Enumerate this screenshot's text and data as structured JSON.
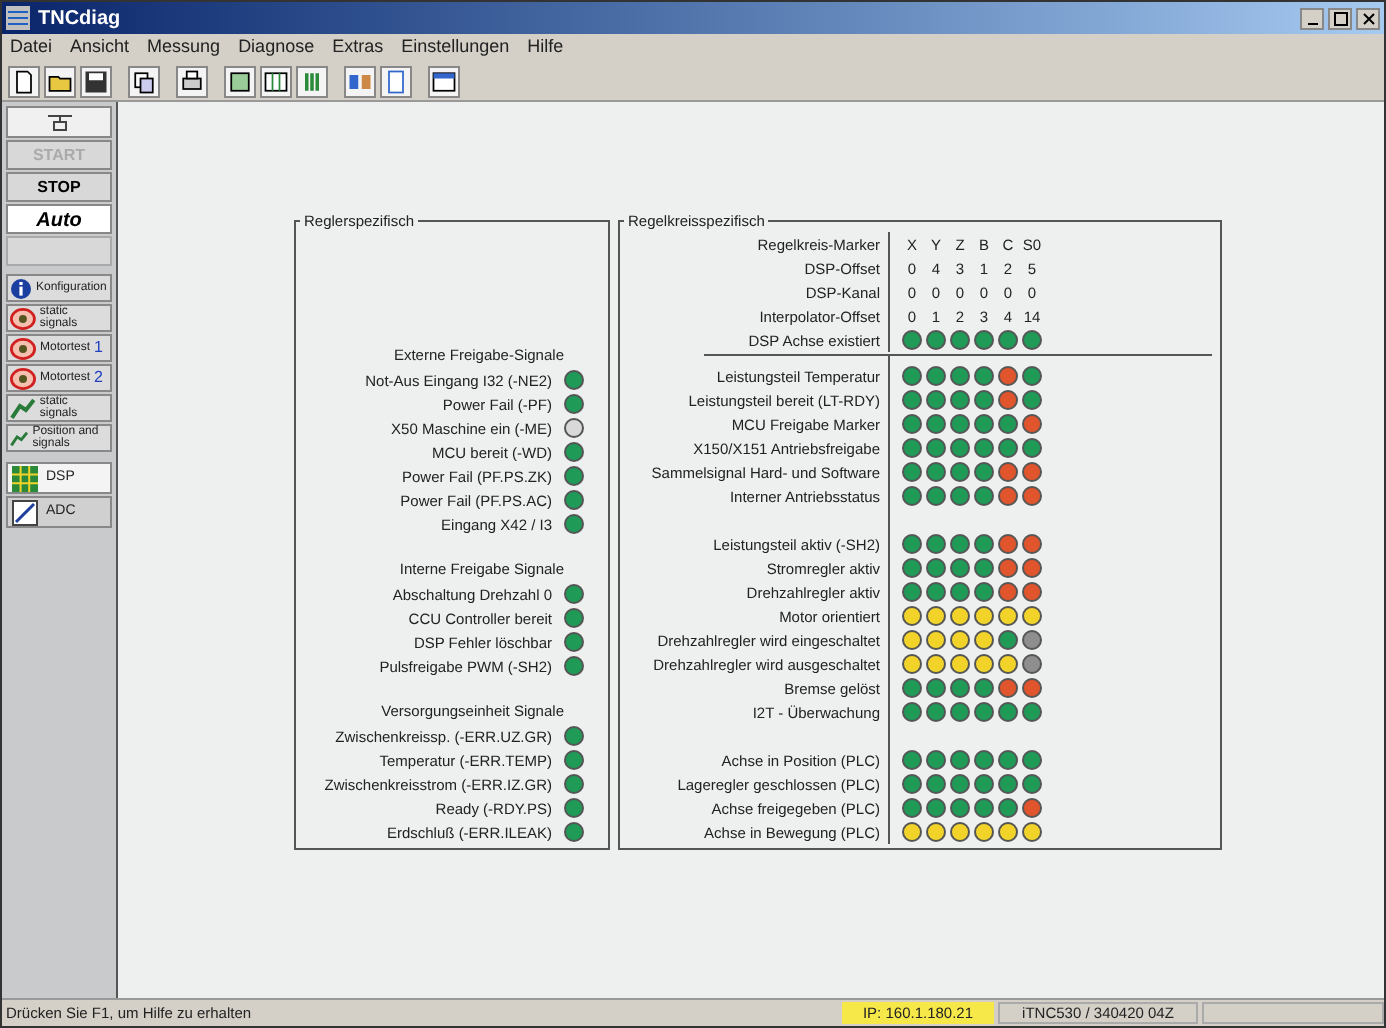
{
  "window": {
    "title": "TNCdiag"
  },
  "menu": [
    "Datei",
    "Ansicht",
    "Messung",
    "Diagnose",
    "Extras",
    "Einstellungen",
    "Hilfe"
  ],
  "sidebar": {
    "buttons": [
      {
        "label": "START",
        "disabled": true,
        "selected": false
      },
      {
        "label": "STOP",
        "disabled": false,
        "selected": false
      },
      {
        "label": "Auto",
        "disabled": false,
        "selected": true
      }
    ],
    "tools": [
      {
        "kind": "info",
        "label": "Konfiguration"
      },
      {
        "kind": "ring",
        "label": "static signals"
      },
      {
        "kind": "ring",
        "label": "Motortest",
        "suffix": "1"
      },
      {
        "kind": "ring",
        "label": "Motortest",
        "suffix": "2"
      },
      {
        "kind": "probe",
        "label": "static signals"
      },
      {
        "kind": "probe",
        "label": "Position and signals"
      }
    ],
    "tabs": [
      {
        "kind": "grid",
        "label": "DSP",
        "selected": true
      },
      {
        "kind": "pen",
        "label": "ADC",
        "selected": false
      }
    ]
  },
  "left_panel": {
    "title": "Reglerspezifisch",
    "groups": [
      {
        "heading": "Externe Freigabe-Signale",
        "rows": [
          {
            "label": "Not-Aus Eingang I32 (-NE2)",
            "color": "#1f9a57"
          },
          {
            "label": "Power Fail (-PF)",
            "color": "#1f9a57"
          },
          {
            "label": "X50 Maschine ein (-ME)",
            "color": "#d9d9d9"
          },
          {
            "label": "MCU bereit (-WD)",
            "color": "#1f9a57"
          },
          {
            "label": "Power Fail (PF.PS.ZK)",
            "color": "#1f9a57"
          },
          {
            "label": "Power Fail (PF.PS.AC)",
            "color": "#1f9a57"
          },
          {
            "label": "Eingang X42 / I3",
            "color": "#1f9a57"
          }
        ]
      },
      {
        "heading": "Interne Freigabe Signale",
        "rows": [
          {
            "label": "Abschaltung Drehzahl 0",
            "color": "#1f9a57"
          },
          {
            "label": "CCU Controller bereit",
            "color": "#1f9a57"
          },
          {
            "label": "DSP Fehler löschbar",
            "color": "#1f9a57"
          },
          {
            "label": "Pulsfreigabe PWM (-SH2)",
            "color": "#1f9a57"
          }
        ]
      },
      {
        "heading": "Versorgungseinheit Signale",
        "rows": [
          {
            "label": "Zwischenkreissp. (-ERR.UZ.GR)",
            "color": "#1f9a57"
          },
          {
            "label": "Temperatur (-ERR.TEMP)",
            "color": "#1f9a57"
          },
          {
            "label": "Zwischenkreisstrom (-ERR.IZ.GR)",
            "color": "#1f9a57"
          },
          {
            "label": "Ready (-RDY.PS)",
            "color": "#1f9a57"
          },
          {
            "label": "Erdschluß (-ERR.ILEAK)",
            "color": "#1f9a57"
          }
        ]
      }
    ]
  },
  "right_panel": {
    "title": "Regelkreisspezifisch",
    "header_rows": [
      {
        "label": "Regelkreis-Marker",
        "values": [
          "X",
          "Y",
          "Z",
          "B",
          "C",
          "S0"
        ]
      },
      {
        "label": "DSP-Offset",
        "values": [
          "0",
          "4",
          "3",
          "1",
          "2",
          "5"
        ]
      },
      {
        "label": "DSP-Kanal",
        "values": [
          "0",
          "0",
          "0",
          "0",
          "0",
          "0"
        ]
      },
      {
        "label": "Interpolator-Offset",
        "values": [
          "0",
          "1",
          "2",
          "3",
          "4",
          "14"
        ]
      }
    ],
    "axis_row": {
      "label": "DSP Achse existiert",
      "lamps": [
        {
          "color": "#1f9a57"
        },
        {
          "color": "#1f9a57"
        },
        {
          "color": "#1f9a57"
        },
        {
          "color": "#1f9a57"
        },
        {
          "color": "#1f9a57"
        },
        {
          "color": "#1f9a57"
        }
      ]
    },
    "groups": [
      [
        {
          "label": "Leistungsteil Temperatur",
          "lamps": [
            {
              "color": "#1f9a57"
            },
            {
              "color": "#1f9a57"
            },
            {
              "color": "#1f9a57"
            },
            {
              "color": "#1f9a57"
            },
            {
              "color": "#e0552b"
            },
            {
              "color": "#1f9a57"
            }
          ]
        },
        {
          "label": "Leistungsteil bereit (LT-RDY)",
          "lamps": [
            {
              "color": "#1f9a57"
            },
            {
              "color": "#1f9a57"
            },
            {
              "color": "#1f9a57"
            },
            {
              "color": "#1f9a57"
            },
            {
              "color": "#e0552b"
            },
            {
              "color": "#1f9a57"
            }
          ]
        },
        {
          "label": "MCU Freigabe Marker",
          "lamps": [
            {
              "color": "#1f9a57"
            },
            {
              "color": "#1f9a57"
            },
            {
              "color": "#1f9a57"
            },
            {
              "color": "#1f9a57"
            },
            {
              "color": "#1f9a57"
            },
            {
              "color": "#e0552b"
            }
          ]
        },
        {
          "label": "X150/X151 Antriebsfreigabe",
          "lamps": [
            {
              "color": "#1f9a57"
            },
            {
              "color": "#1f9a57"
            },
            {
              "color": "#1f9a57"
            },
            {
              "color": "#1f9a57"
            },
            {
              "color": "#1f9a57"
            },
            {
              "color": "#1f9a57"
            }
          ]
        },
        {
          "label": "Sammelsignal Hard- und Software",
          "lamps": [
            {
              "color": "#1f9a57"
            },
            {
              "color": "#1f9a57"
            },
            {
              "color": "#1f9a57"
            },
            {
              "color": "#1f9a57"
            },
            {
              "color": "#e0552b"
            },
            {
              "color": "#e0552b"
            }
          ]
        },
        {
          "label": "Interner Antriebsstatus",
          "lamps": [
            {
              "color": "#1f9a57"
            },
            {
              "color": "#1f9a57"
            },
            {
              "color": "#1f9a57"
            },
            {
              "color": "#1f9a57"
            },
            {
              "color": "#e0552b"
            },
            {
              "color": "#e0552b"
            }
          ]
        }
      ],
      [
        {
          "label": "Leistungsteil aktiv (-SH2)",
          "lamps": [
            {
              "color": "#1f9a57"
            },
            {
              "color": "#1f9a57"
            },
            {
              "color": "#1f9a57"
            },
            {
              "color": "#1f9a57"
            },
            {
              "color": "#e0552b"
            },
            {
              "color": "#e0552b"
            }
          ]
        },
        {
          "label": "Stromregler aktiv",
          "lamps": [
            {
              "color": "#1f9a57"
            },
            {
              "color": "#1f9a57"
            },
            {
              "color": "#1f9a57"
            },
            {
              "color": "#1f9a57"
            },
            {
              "color": "#e0552b"
            },
            {
              "color": "#e0552b"
            }
          ]
        },
        {
          "label": "Drehzahlregler aktiv",
          "lamps": [
            {
              "color": "#1f9a57"
            },
            {
              "color": "#1f9a57"
            },
            {
              "color": "#1f9a57"
            },
            {
              "color": "#1f9a57"
            },
            {
              "color": "#e0552b"
            },
            {
              "color": "#e0552b"
            }
          ]
        },
        {
          "label": "Motor orientiert",
          "lamps": [
            {
              "color": "#f2d32a"
            },
            {
              "color": "#f2d32a"
            },
            {
              "color": "#f2d32a"
            },
            {
              "color": "#f2d32a"
            },
            {
              "color": "#f2d32a"
            },
            {
              "color": "#f2d32a"
            }
          ]
        },
        {
          "label": "Drehzahlregler wird eingeschaltet",
          "lamps": [
            {
              "color": "#f2d32a"
            },
            {
              "color": "#f2d32a"
            },
            {
              "color": "#f2d32a"
            },
            {
              "color": "#f2d32a"
            },
            {
              "color": "#1f9a57"
            },
            {
              "color": "#8e8e8e"
            }
          ]
        },
        {
          "label": "Drehzahlregler wird ausgeschaltet",
          "lamps": [
            {
              "color": "#f2d32a"
            },
            {
              "color": "#f2d32a"
            },
            {
              "color": "#f2d32a"
            },
            {
              "color": "#f2d32a"
            },
            {
              "color": "#f2d32a"
            },
            {
              "color": "#8e8e8e"
            }
          ]
        },
        {
          "label": "Bremse gelöst",
          "lamps": [
            {
              "color": "#1f9a57"
            },
            {
              "color": "#1f9a57"
            },
            {
              "color": "#1f9a57"
            },
            {
              "color": "#1f9a57"
            },
            {
              "color": "#e0552b"
            },
            {
              "color": "#e0552b"
            }
          ]
        },
        {
          "label": "I2T - Überwachung",
          "lamps": [
            {
              "color": "#1f9a57"
            },
            {
              "color": "#1f9a57"
            },
            {
              "color": "#1f9a57"
            },
            {
              "color": "#1f9a57"
            },
            {
              "color": "#1f9a57"
            },
            {
              "color": "#1f9a57"
            }
          ]
        }
      ],
      [
        {
          "label": "Achse in Position (PLC)",
          "lamps": [
            {
              "color": "#1f9a57"
            },
            {
              "color": "#1f9a57"
            },
            {
              "color": "#1f9a57"
            },
            {
              "color": "#1f9a57"
            },
            {
              "color": "#1f9a57"
            },
            {
              "color": "#1f9a57"
            }
          ]
        },
        {
          "label": "Lageregler geschlossen (PLC)",
          "lamps": [
            {
              "color": "#1f9a57"
            },
            {
              "color": "#1f9a57"
            },
            {
              "color": "#1f9a57"
            },
            {
              "color": "#1f9a57"
            },
            {
              "color": "#1f9a57"
            },
            {
              "color": "#1f9a57"
            }
          ]
        },
        {
          "label": "Achse freigegeben (PLC)",
          "lamps": [
            {
              "color": "#1f9a57"
            },
            {
              "color": "#1f9a57"
            },
            {
              "color": "#1f9a57"
            },
            {
              "color": "#1f9a57"
            },
            {
              "color": "#1f9a57"
            },
            {
              "color": "#e0552b"
            }
          ]
        },
        {
          "label": "Achse in Bewegung (PLC)",
          "lamps": [
            {
              "color": "#f2d32a"
            },
            {
              "color": "#f2d32a"
            },
            {
              "color": "#f2d32a"
            },
            {
              "color": "#f2d32a"
            },
            {
              "color": "#f2d32a"
            },
            {
              "color": "#f2d32a"
            }
          ]
        }
      ]
    ]
  },
  "status_bar": {
    "message": "Drücken Sie F1, um Hilfe zu erhalten",
    "ip": "IP: 160.1.180.21",
    "control": "iTNC530 / 340420 04Z"
  }
}
